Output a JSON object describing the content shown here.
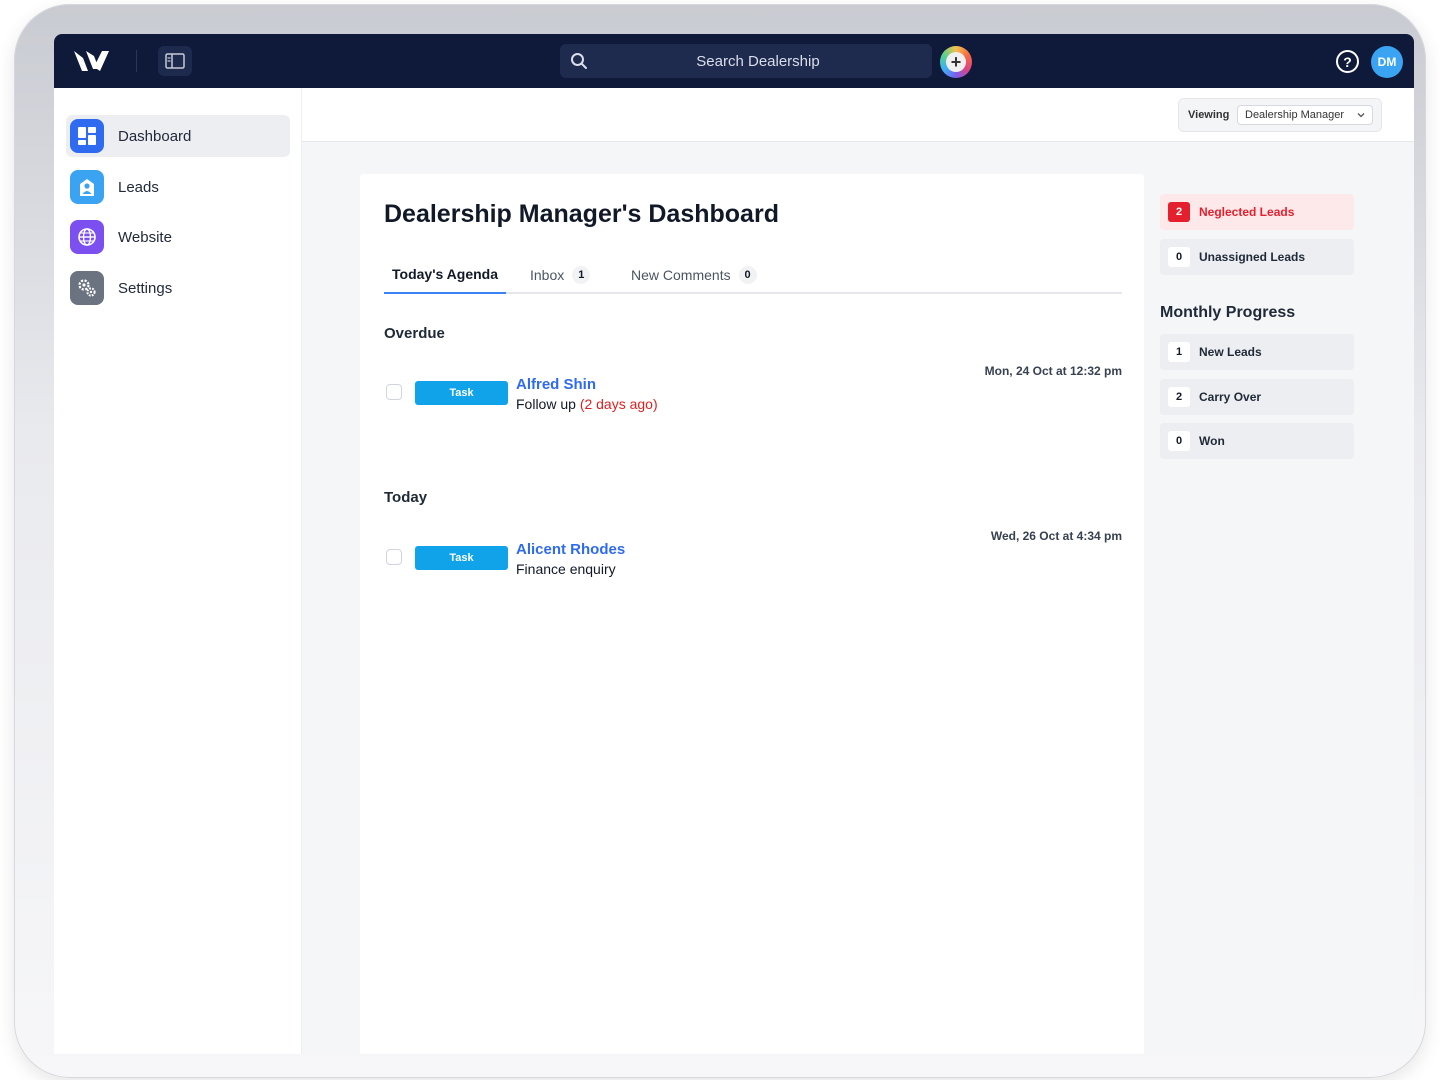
{
  "search": {
    "placeholder": "Search Dealership"
  },
  "user": {
    "initials": "DM"
  },
  "help": {
    "glyph": "?"
  },
  "add": {
    "glyph": "+"
  },
  "sidebar": {
    "items": [
      {
        "label": "Dashboard",
        "icon": "dashboard-icon",
        "color": "#2f6bf0"
      },
      {
        "label": "Leads",
        "icon": "leads-icon",
        "color": "#3aa3f2"
      },
      {
        "label": "Website",
        "icon": "globe-icon",
        "color": "#7c4ff0"
      },
      {
        "label": "Settings",
        "icon": "gear-icon",
        "color": "#6b7280"
      }
    ]
  },
  "viewing": {
    "label": "Viewing",
    "value": "Dealership Manager"
  },
  "main": {
    "title": "Dealership Manager's Dashboard",
    "tabs": [
      {
        "label": "Today's Agenda",
        "count": ""
      },
      {
        "label": "Inbox",
        "count": "1"
      },
      {
        "label": "New Comments",
        "count": "0"
      }
    ],
    "sections": [
      {
        "title": "Overdue",
        "tasks": [
          {
            "badge": "Task",
            "name": "Alfred Shin",
            "desc": "Follow up",
            "ago": "(2 days ago)",
            "date": "Mon, 24 Oct at 12:32 pm"
          }
        ]
      },
      {
        "title": "Today",
        "tasks": [
          {
            "badge": "Task",
            "name": "Alicent Rhodes",
            "desc": "Finance enquiry",
            "ago": "",
            "date": "Wed, 26 Oct at 4:34 pm"
          }
        ]
      }
    ]
  },
  "alerts": [
    {
      "count": "2",
      "label": "Neglected Leads"
    },
    {
      "count": "0",
      "label": "Unassigned Leads"
    }
  ],
  "monthly": {
    "title": "Monthly Progress",
    "items": [
      {
        "count": "1",
        "label": "New Leads"
      },
      {
        "count": "2",
        "label": "Carry Over"
      },
      {
        "count": "0",
        "label": "Won"
      }
    ]
  },
  "colors": {
    "topbar": "#0f1a3a",
    "accent": "#2f6bf0",
    "task_badge": "#10a3ea",
    "alert": "#e5202e"
  }
}
